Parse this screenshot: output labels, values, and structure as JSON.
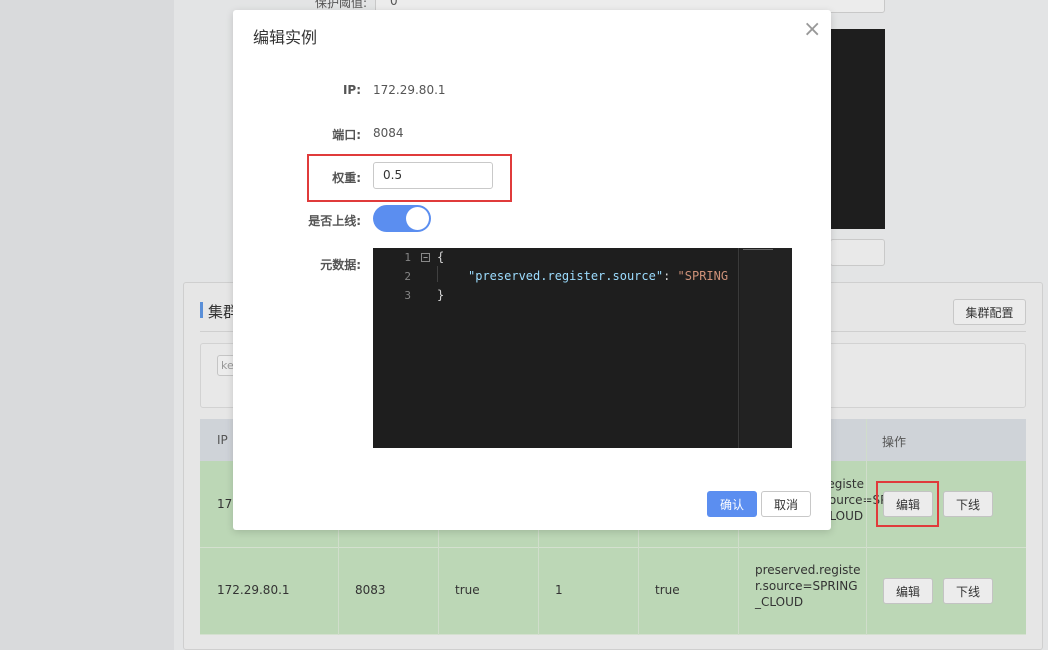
{
  "background": {
    "top_label": "保护阈值:",
    "top_value": "0",
    "cluster": {
      "title": "集群",
      "config_button": "集群配置",
      "filter_placeholder": "ke"
    },
    "table": {
      "headers": [
        "IP",
        "操作"
      ],
      "rows": [
        {
          "ip": "172.",
          "port": "",
          "ephemeral": "",
          "weight": "",
          "healthy": "",
          "metadata": "r.registe\nr.source=SPRING\n_CLOUD",
          "edit": "编辑",
          "offline": "下线"
        },
        {
          "ip": "172.29.80.1",
          "port": "8083",
          "ephemeral": "true",
          "weight": "1",
          "healthy": "true",
          "metadata": "preserved.registe\nr.source=SPRING\n_CLOUD",
          "edit": "编辑",
          "offline": "下线"
        }
      ]
    }
  },
  "modal": {
    "title": "编辑实例",
    "close_icon": "close-icon",
    "ip_label": "IP:",
    "ip_value": "172.29.80.1",
    "port_label": "端口:",
    "port_value": "8084",
    "weight_label": "权重:",
    "weight_value": "0.5",
    "online_label": "是否上线:",
    "online": true,
    "metadata_label": "元数据:",
    "editor": {
      "line_numbers": [
        "1",
        "2",
        "3"
      ],
      "open_brace": "{",
      "key": "\"preserved.register.source\"",
      "colon": ": ",
      "value": "\"SPRING",
      "close_brace": "}"
    },
    "confirm_button": "确认",
    "cancel_button": "取消"
  },
  "colors": {
    "accent": "#5b8ef0",
    "highlight_border": "#e03b3b",
    "row_green": "#bcd7b6"
  }
}
